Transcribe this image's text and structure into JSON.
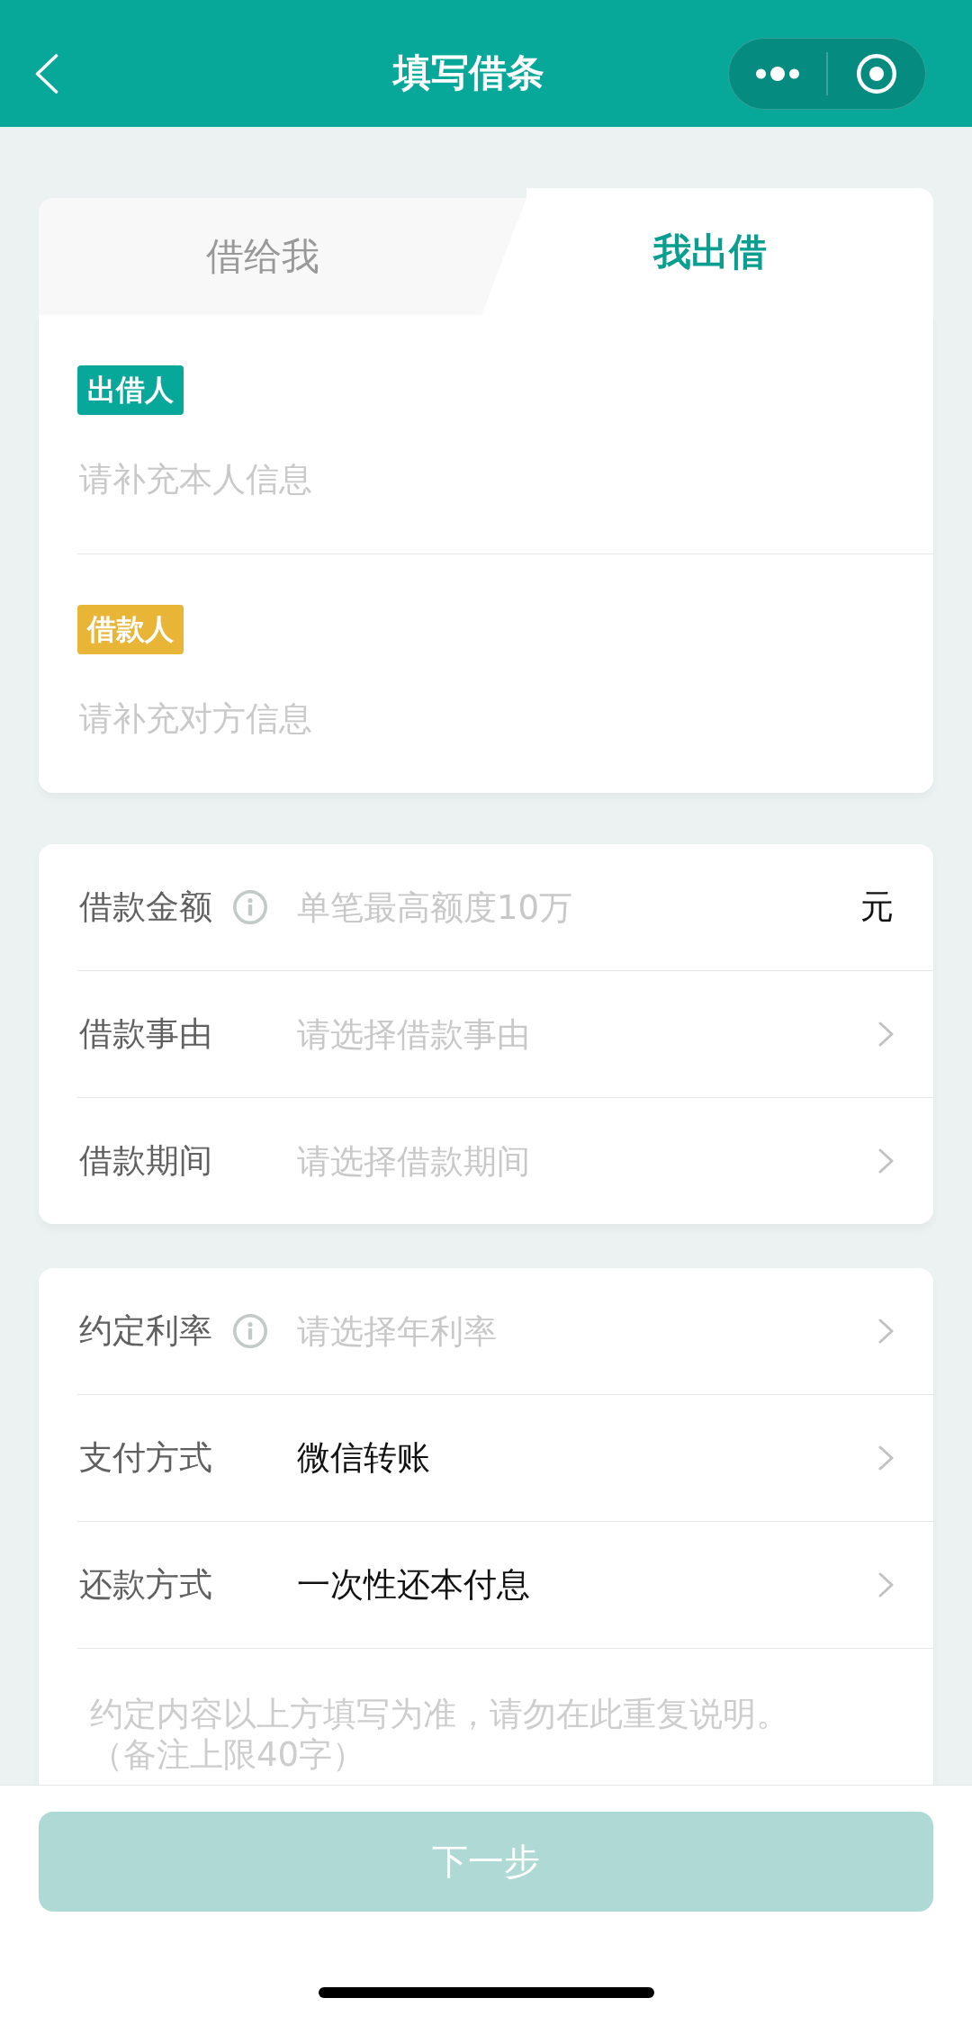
{
  "nav_bar": {
    "title": "填写借条"
  },
  "tabs": [
    {
      "label": "借给我",
      "selected": false
    },
    {
      "label": "我出借",
      "selected": true
    }
  ],
  "parties": [
    {
      "tag": "出借人",
      "color": "#07a899",
      "placeholder": "请补充本人信息"
    },
    {
      "tag": "借款人",
      "color": "#e8b536",
      "placeholder": "请补充对方信息"
    }
  ],
  "loan_details": [
    {
      "kind": "input",
      "label": "借款金额",
      "info": true,
      "placeholder": "单笔最高额度10万",
      "unit": "元"
    },
    {
      "kind": "select",
      "label": "借款事由",
      "info": false,
      "placeholder": "请选择借款事由"
    },
    {
      "kind": "select",
      "label": "借款期间",
      "info": false,
      "placeholder": "请选择借款期间"
    }
  ],
  "terms": [
    {
      "kind": "select",
      "label": "约定利率",
      "info": true,
      "placeholder": "请选择年利率"
    },
    {
      "kind": "select",
      "label": "支付方式",
      "info": false,
      "value": "微信转账"
    },
    {
      "kind": "select",
      "label": "还款方式",
      "info": false,
      "value": "一次性还本付息"
    }
  ],
  "remark": {
    "placeholder": "约定内容以上方填写为准，请勿在此重复说明。（备注上限40字）"
  },
  "next_button": {
    "label": "下一步",
    "disabled": true
  }
}
